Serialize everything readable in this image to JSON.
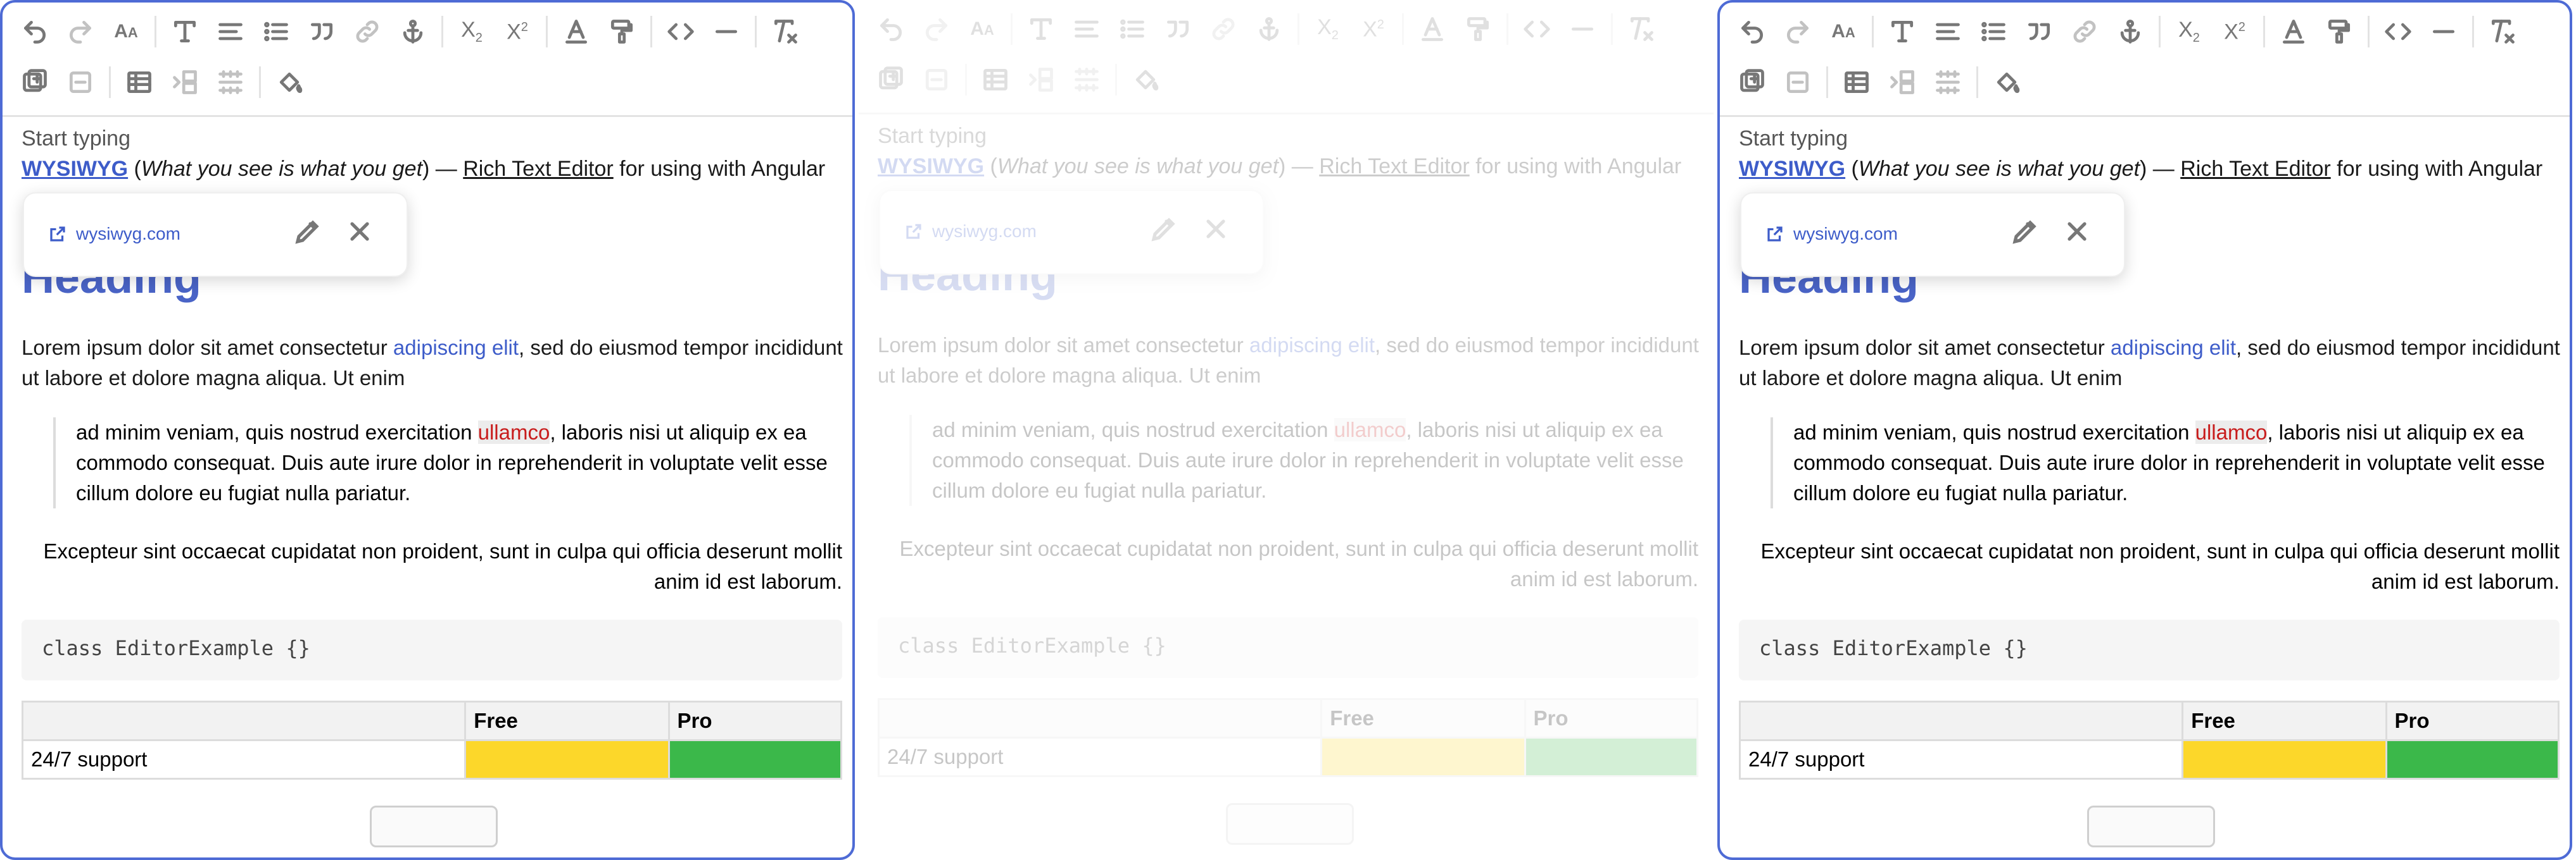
{
  "editor": {
    "placeholder": "Start typing",
    "intro": {
      "wysiwyg": "WYSIWYG",
      "paren_open": " (",
      "italic": "What you see is what you get",
      "paren_close": ") — ",
      "rte": "Rich Text Editor",
      "tail": " for using with Angular"
    },
    "link_popup": {
      "url": "wysiwyg.com"
    },
    "heading": "Heading",
    "lorem": {
      "part1": "Lorem ipsum dolor sit amet consectetur ",
      "highlight": "adipiscing elit",
      "part2": ", sed do eiusmod tempor incididunt ut labore et dolore magna aliqua. Ut enim"
    },
    "quote": {
      "part1": "ad minim veniam, quis nostrud exercitation ",
      "red": "ullamco",
      "part2": ", laboris nisi ut aliquip ex ea commodo consequat. Duis aute irure dolor in reprehenderit in voluptate velit esse cillum dolore eu fugiat nulla pariatur."
    },
    "right_aligned": "Excepteur sint occaecat cupidatat non proident, sunt in culpa qui officia deserunt mollit anim id est laborum.",
    "code": "class EditorExample {}",
    "table": {
      "headers": [
        "",
        "Free",
        "Pro"
      ],
      "rows": [
        [
          "24/7 support",
          "",
          ""
        ]
      ]
    }
  },
  "colors": {
    "accent": "#4a64c7",
    "link": "#3d5cc9",
    "red": "#c81c1c",
    "yellow": "#fcd72a",
    "green": "#3bb84a"
  },
  "icons": [
    "undo-icon",
    "redo-icon",
    "font-size-icon",
    "text-style-icon",
    "align-icon",
    "bullet-list-icon",
    "blockquote-icon",
    "link-icon",
    "anchor-icon",
    "subscript-icon",
    "superscript-icon",
    "text-color-icon",
    "highlight-icon",
    "code-icon",
    "horizontal-rule-icon",
    "clear-format-icon",
    "insert-row-icon",
    "remove-row-icon",
    "table-icon",
    "insert-column-icon",
    "merge-cells-icon",
    "cell-color-icon"
  ]
}
